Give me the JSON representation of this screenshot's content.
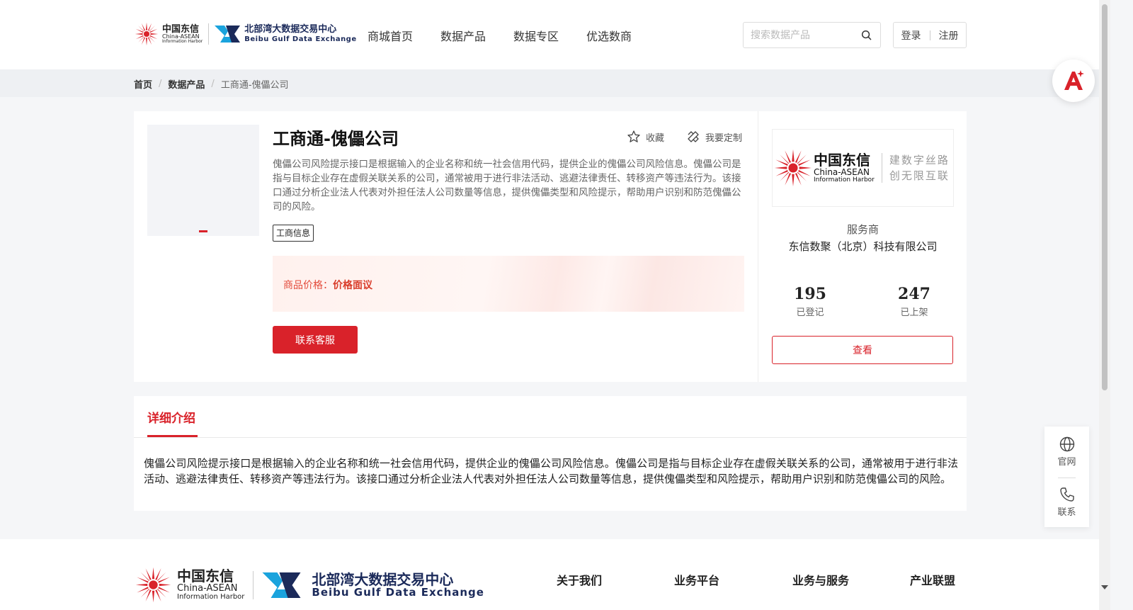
{
  "header": {
    "brand": {
      "cd_cn": "中国东信",
      "cd_en1": "China-ASEAN",
      "cd_en2": "Information Harbor",
      "bx_cn": "北部湾大数据交易中心",
      "bx_en": "Beibu Gulf Data Exchange"
    },
    "nav": [
      "商城首页",
      "数据产品",
      "数据专区",
      "优选数商"
    ],
    "search": {
      "placeholder": "搜索数据产品",
      "value": ""
    },
    "login": "登录",
    "register": "注册"
  },
  "breadcrumb": {
    "home": "首页",
    "category": "数据产品",
    "current": "工商通-傀儡公司"
  },
  "product": {
    "title": "工商通-傀儡公司",
    "favorite": "收藏",
    "customize": "我要定制",
    "description": "傀儡公司风险提示接口是根据输入的企业名称和统一社会信用代码，提供企业的傀儡公司风险信息。傀儡公司是指与目标企业存在虚假关联关系的公司，通常被用于进行非法活动、逃避法律责任、转移资产等违法行为。该接口通过分析企业法人代表对外担任法人公司数量等信息，提供傀儡类型和风险提示，帮助用户识别和防范傀儡公司的风险。",
    "tag": "工商信息",
    "price_label": "商品价格：",
    "price_value": "价格面议",
    "contact_button": "联系客服"
  },
  "provider": {
    "logo_cn": "中国东信",
    "logo_en1": "China-ASEAN",
    "logo_en2": "Information Harbor",
    "slogan1": "建数字丝路",
    "slogan2": "创无限互联",
    "label": "服务商",
    "name": "东信数聚（北京）科技有限公司",
    "registered_count": "195",
    "registered_label": "已登记",
    "listed_count": "247",
    "listed_label": "已上架",
    "view_button": "查看"
  },
  "detail": {
    "tab": "详细介绍",
    "text": "傀儡公司风险提示接口是根据输入的企业名称和统一社会信用代码，提供企业的傀儡公司风险信息。傀儡公司是指与目标企业存在虚假关联关系的公司，通常被用于进行非法活动、逃避法律责任、转移资产等违法行为。该接口通过分析企业法人代表对外担任法人公司数量等信息，提供傀儡类型和风险提示，帮助用户识别和防范傀儡公司的风险。"
  },
  "footer": {
    "cd_cn": "中国东信",
    "cd_en1": "China-ASEAN",
    "cd_en2": "Information Harbor",
    "bx_cn": "北部湾大数据交易中心",
    "bx_en": "Beibu Gulf Data Exchange",
    "links": [
      "关于我们",
      "业务平台",
      "业务与服务",
      "产业联盟"
    ]
  },
  "side_panel": {
    "website": "官网",
    "contact": "联系"
  },
  "colors": {
    "accent": "#d9222a",
    "navy": "#1b2a5a",
    "background": "#f5f6f8"
  },
  "icons": [
    "search-icon",
    "star-icon",
    "customize-icon",
    "globe-icon",
    "phone-icon",
    "ai-assistant-icon"
  ]
}
